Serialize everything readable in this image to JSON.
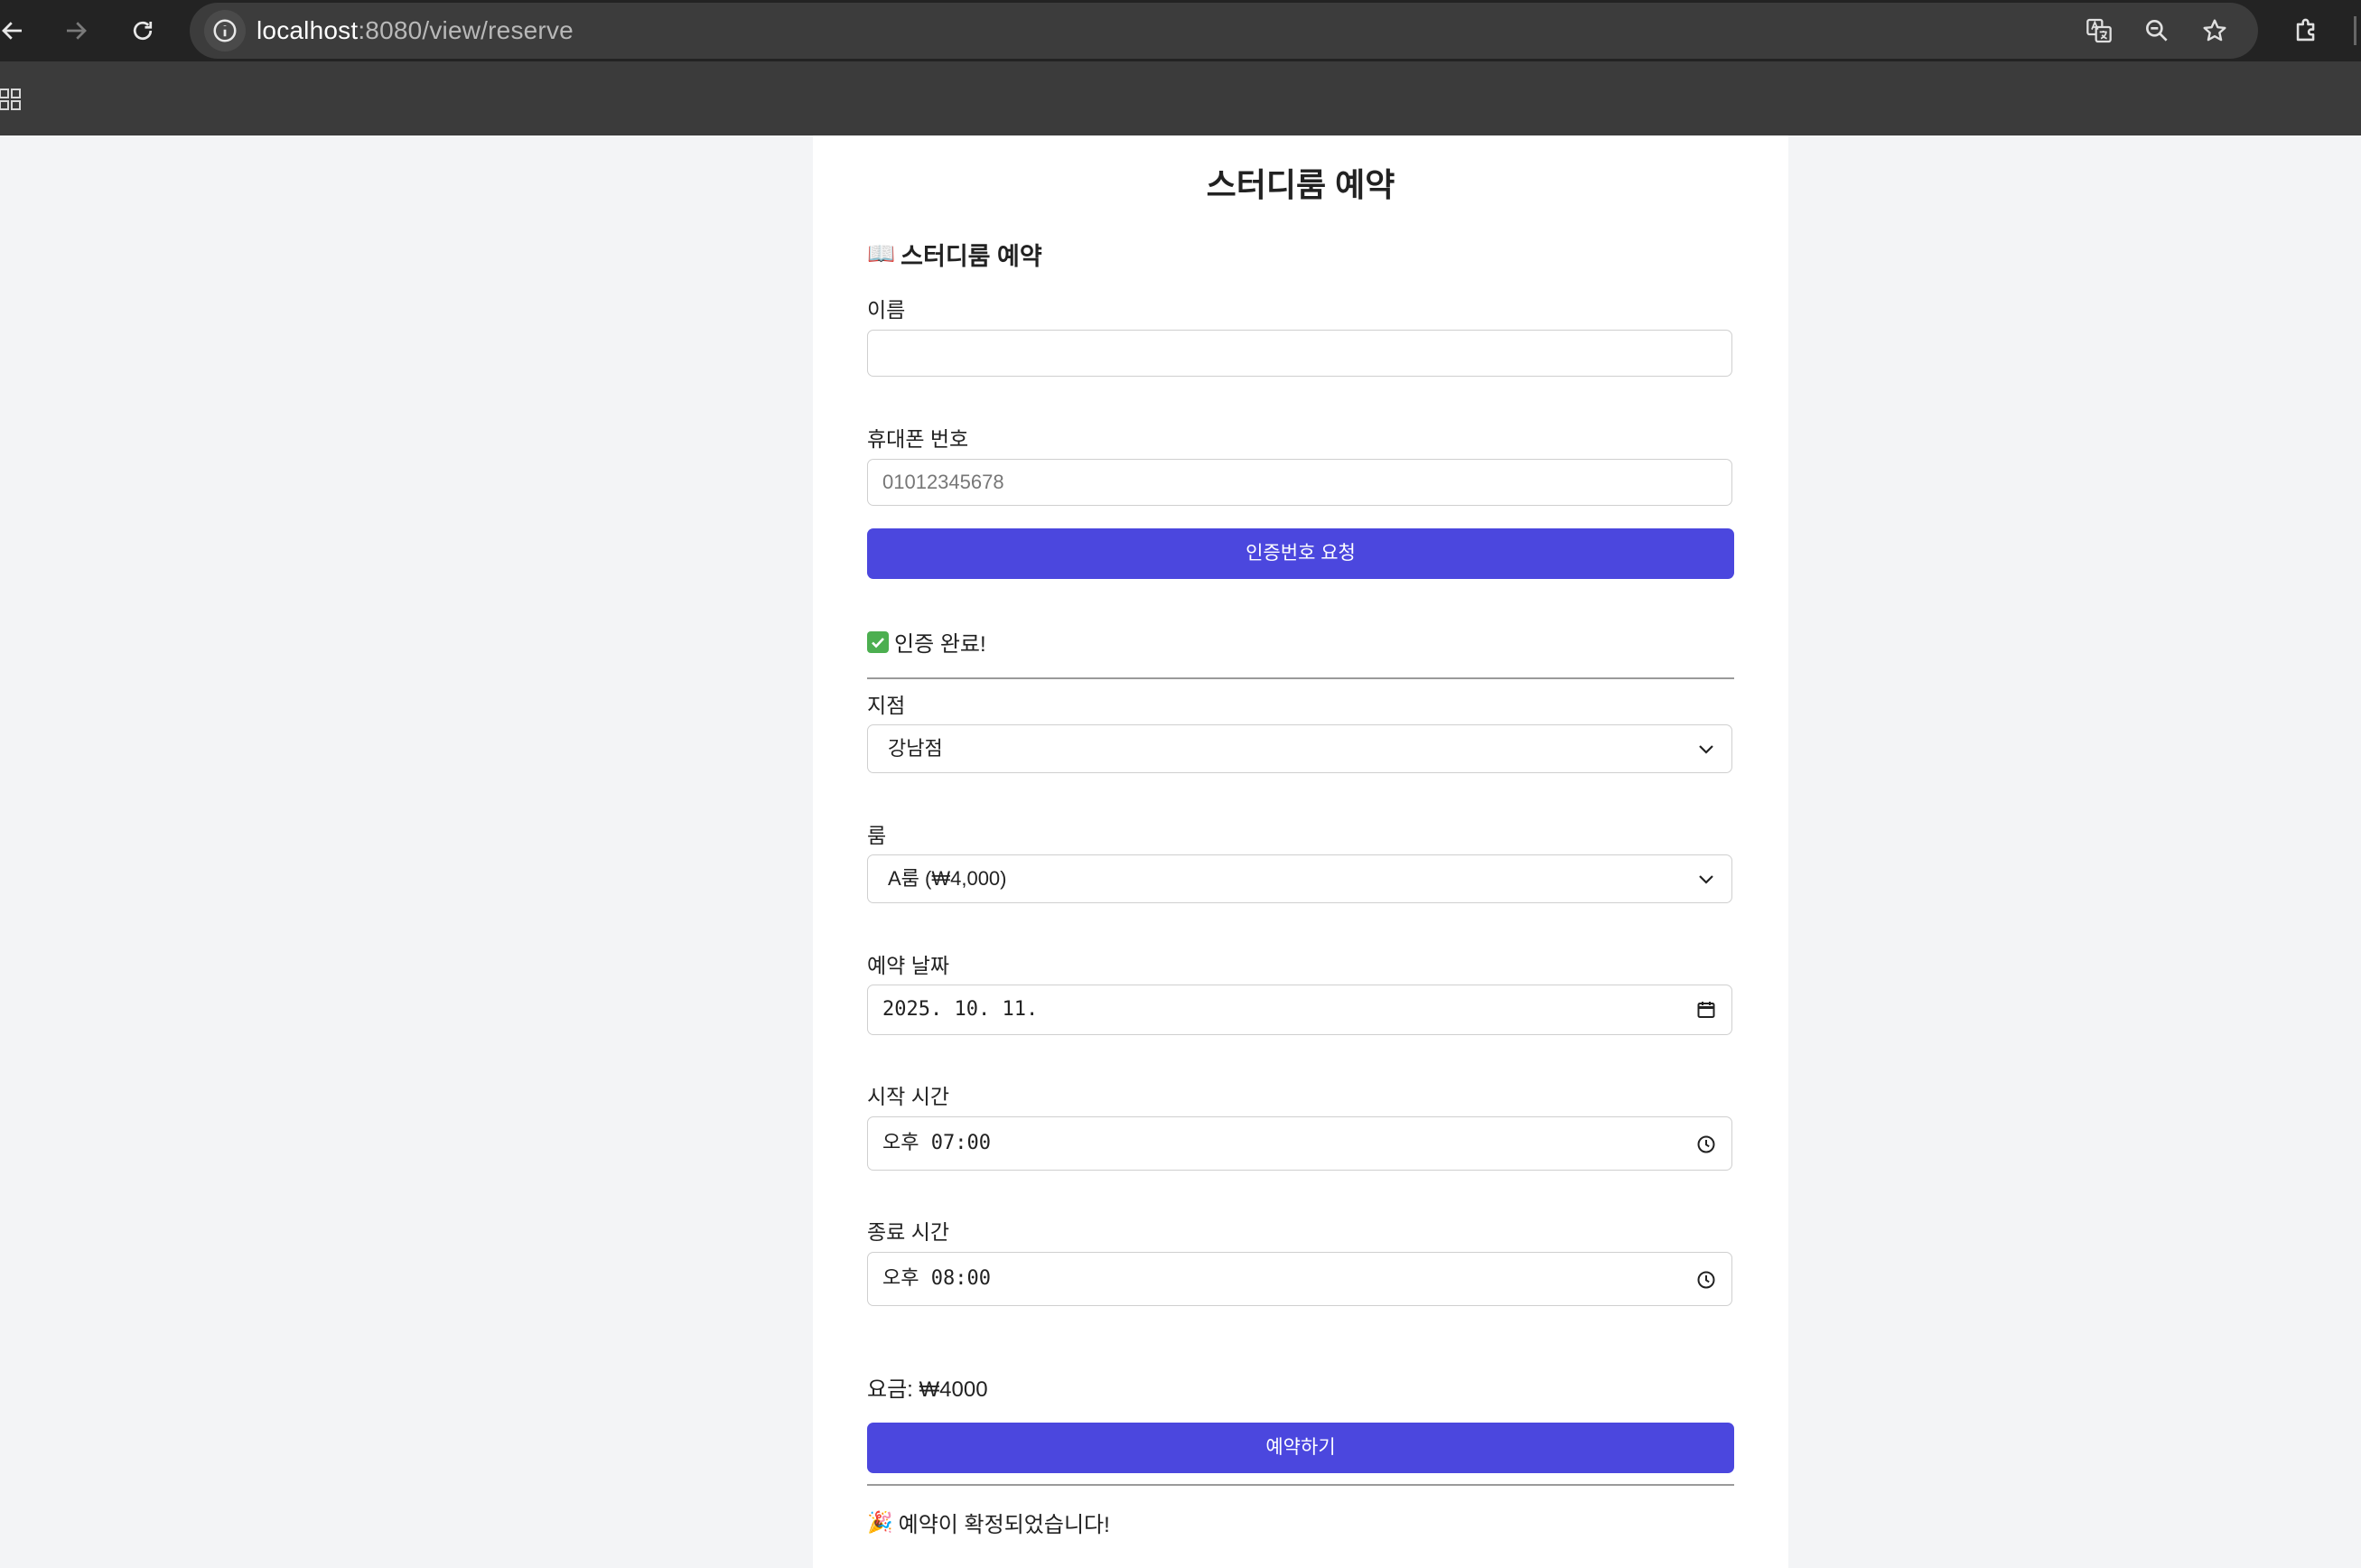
{
  "browser": {
    "url_host": "localhost",
    "url_path": ":8080/view/reserve"
  },
  "page": {
    "title": "스터디룸 예약",
    "section_title": "스터디룸 예약",
    "section_icon": "📖"
  },
  "form": {
    "name_label": "이름",
    "name_value": "",
    "phone_label": "휴대폰 번호",
    "phone_placeholder": "01012345678",
    "verify_button": "인증번호 요청",
    "verify_status": "인증 완료!",
    "branch_label": "지점",
    "branch_value": "강남점",
    "room_label": "룸",
    "room_value": "A룸 (₩4,000)",
    "date_label": "예약 날짜",
    "date_value": "2025. 10. 11.",
    "start_label": "시작 시간",
    "start_value": "오후 07:00",
    "end_label": "종료 시간",
    "end_value": "오후 08:00",
    "price_text": "요금: ₩4000",
    "submit_button": "예약하기",
    "confirm_icon": "🎉",
    "confirm_text": "예약이 확정되었습니다!"
  },
  "colors": {
    "accent": "#4b47de",
    "chrome_dark": "#232323",
    "page_bg": "#f3f4f6"
  }
}
